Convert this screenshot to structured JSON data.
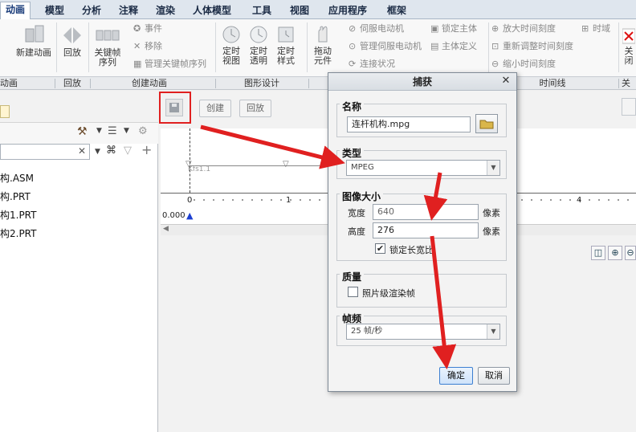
{
  "ribbon": {
    "tabs": [
      "动画",
      "模型",
      "分析",
      "注释",
      "渲染",
      "人体模型",
      "工具",
      "视图",
      "应用程序",
      "框架"
    ],
    "buttons": {
      "new_animation": "新建动画",
      "playback": "回放",
      "keyframe_seq": "关键帧序列",
      "event": "事件",
      "remove": "移除",
      "manage_keyframe_seq": "管理关键帧序列",
      "timed_view": "定时视图",
      "timed_transparency": "定时透明",
      "timed_style": "定时样式",
      "drag_element": "拖动元件",
      "servo_motor": "伺服电动机",
      "manage_servo_motor": "管理伺服电动机",
      "connection_status": "连接状况",
      "lock_body": "锁定主体",
      "body_definition": "主体定义",
      "zoom_in_scale": "放大时间刻度",
      "readjust_scale": "重新调整时间刻度",
      "zoom_out_scale": "缩小时间刻度",
      "time_domain": "时域",
      "close": "关闭"
    },
    "groups": {
      "animation": "动画",
      "playback": "回放",
      "create_animation": "创建动画",
      "graphic_design": "图形设计",
      "timeline": "时间线",
      "close": "关闭"
    }
  },
  "left_panel": {
    "tree": [
      "构.ASM",
      "构.PRT",
      "构1.PRT",
      "构2.PRT"
    ]
  },
  "timeline": {
    "save_tooltip": "保存",
    "create_label": "创建",
    "playback_label": "回放",
    "kfs_label": "Kfs1.1",
    "ticks": [
      "0",
      "1",
      "4"
    ],
    "current_time": "0.000"
  },
  "dialog": {
    "title": "捕获",
    "name_section": "名称",
    "name_value": "连杆机构.mpg",
    "type_section": "类型",
    "type_value": "MPEG",
    "size_section": "图像大小",
    "width_label": "宽度",
    "width_value": "640",
    "height_label": "高度",
    "height_value": "276",
    "unit": "像素",
    "lock_ratio": "锁定长宽比",
    "quality_section": "质量",
    "photo_render": "照片级渲染帧",
    "fps_section": "帧频",
    "fps_value": "25 帧/秒",
    "ok": "确定",
    "cancel": "取消"
  },
  "colors": {
    "annotation_red": "#e02020",
    "accent_blue": "#3c7fd1"
  }
}
